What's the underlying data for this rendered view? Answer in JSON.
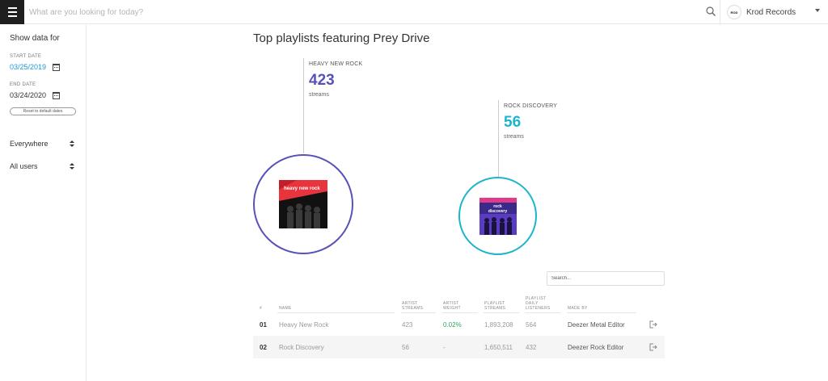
{
  "topbar": {
    "search_placeholder": "What are you looking for today?",
    "account_name": "Krod Records",
    "account_logo_text": "ROD"
  },
  "sidebar": {
    "title": "Show data for",
    "start_label": "START DATE",
    "start_date": "03/25/2019",
    "end_label": "END DATE",
    "end_date": "03/24/2020",
    "reset_label": "Reset to default dates",
    "region": "Everywhere",
    "users": "All users"
  },
  "page_title": "Top playlists featuring Prey Drive",
  "bubbles": [
    {
      "name": "HEAVY NEW ROCK",
      "streams": "423",
      "unit": "streams",
      "cover_text": "heavy new rock",
      "color": "#5852b8"
    },
    {
      "name": "ROCK DISCOVERY",
      "streams": "56",
      "unit": "streams",
      "cover_text": "rock discovery",
      "color": "#1bb5cc"
    }
  ],
  "table": {
    "search_placeholder": "Search...",
    "headers": {
      "num": "#",
      "name": "NAME",
      "artist_streams": "ARTIST STREAMS",
      "artist_weight": "ARTIST WEIGHT",
      "playlist_streams": "PLAYLIST STREAMS",
      "daily_listeners": "PLAYLIST DAILY LISTENERS",
      "made_by": "MADE BY"
    },
    "rows": [
      {
        "num": "01",
        "name": "Heavy New Rock",
        "artist_streams": "423",
        "artist_weight": "0.02%",
        "playlist_streams": "1,893,208",
        "daily_listeners": "564",
        "made_by": "Deezer Metal Editor"
      },
      {
        "num": "02",
        "name": "Rock Discovery",
        "artist_streams": "56",
        "artist_weight": "-",
        "playlist_streams": "1,650,511",
        "daily_listeners": "432",
        "made_by": "Deezer Rock Editor"
      }
    ]
  },
  "colors": {
    "accent_blue": "#1a9ad6",
    "purple": "#5852b8",
    "teal": "#1bb5cc",
    "green": "#2cab5a"
  }
}
